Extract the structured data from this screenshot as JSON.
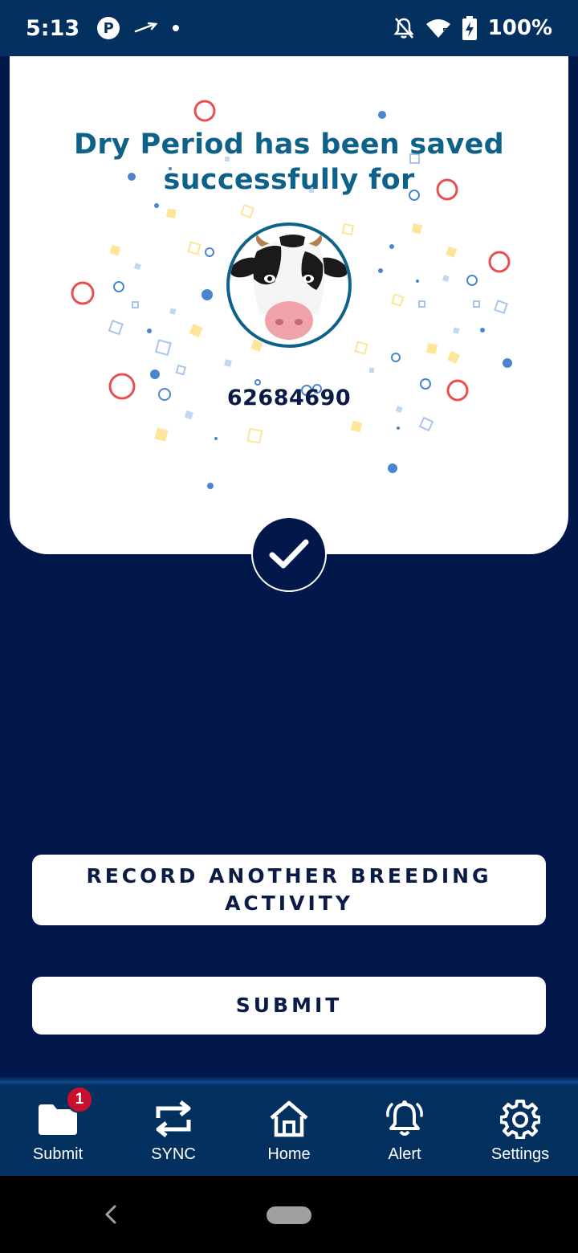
{
  "status_bar": {
    "time": "5:13",
    "p_icon": "P",
    "battery": "100%"
  },
  "card": {
    "title": "Dry Period has been saved successfully for",
    "animal_id": "62684690",
    "avatar_icon": "cow-face-icon"
  },
  "actions": {
    "record_another": "RECORD ANOTHER BREEDING ACTIVITY",
    "submit": "SUBMIT"
  },
  "bottom_nav": {
    "items": [
      {
        "label": "Submit",
        "icon": "folder-icon",
        "badge": "1"
      },
      {
        "label": "SYNC",
        "icon": "sync-icon"
      },
      {
        "label": "Home",
        "icon": "home-icon"
      },
      {
        "label": "Alert",
        "icon": "bell-icon"
      },
      {
        "label": "Settings",
        "icon": "gear-icon"
      }
    ]
  },
  "colors": {
    "background": "#03184a",
    "status_bar": "#03305f",
    "title": "#0e6289",
    "badge": "#c8102e"
  }
}
